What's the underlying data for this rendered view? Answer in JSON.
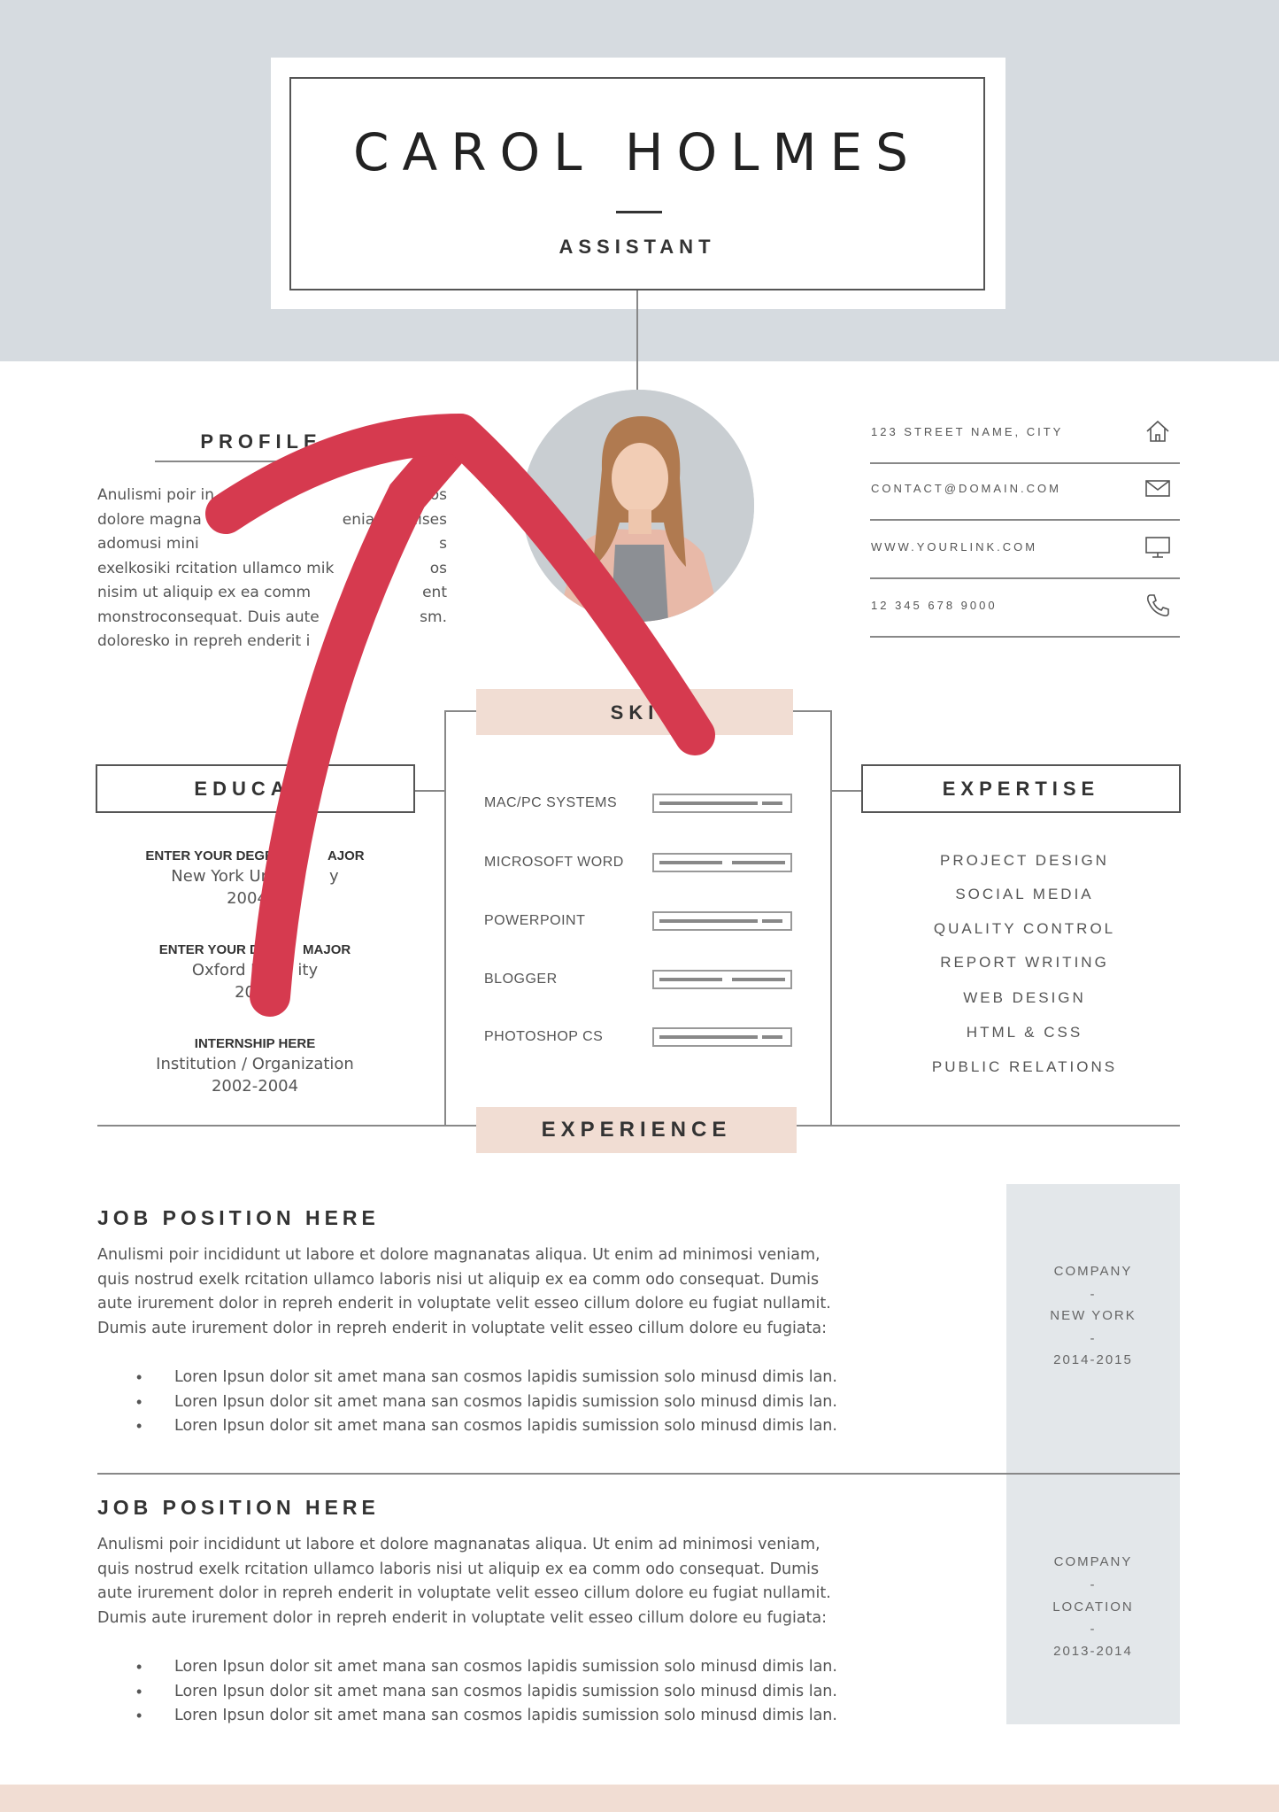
{
  "header": {
    "name": "CAROL HOLMES",
    "title": "ASSISTANT"
  },
  "profile": {
    "heading": "PROFILE",
    "lines": [
      "Anulismi poir in",
      "dolore magna",
      "adomusi mini",
      "exelkosiki rcitation ullamco mik",
      "nisim ut aliquip ex ea comm",
      "monstroconsequat. Duis aute",
      "doloresko in repreh enderit i"
    ],
    "lines_right": [
      "",
      "otipos",
      "eniam, quises",
      "s",
      "os",
      "ent",
      "sm."
    ]
  },
  "contact": [
    {
      "label": "123 STREET NAME, CITY",
      "icon": "home-icon"
    },
    {
      "label": "CONTACT@DOMAIN.COM",
      "icon": "mail-icon"
    },
    {
      "label": "WWW.YOURLINK.COM",
      "icon": "monitor-icon"
    },
    {
      "label": "12 345 678 9000",
      "icon": "phone-icon"
    }
  ],
  "skills": {
    "heading": "SKI",
    "items": [
      {
        "label": "MAC/PC SYSTEMS",
        "level": 0.88
      },
      {
        "label": "MICROSOFT WORD",
        "level": 0.75
      },
      {
        "label": "POWERPOINT",
        "level": 0.88
      },
      {
        "label": "BLOGGER",
        "level": 0.75
      },
      {
        "label": "PHOTOSHOP CS",
        "level": 0.88
      }
    ]
  },
  "education": {
    "heading": "EDUCATI",
    "items": [
      {
        "degree": "ENTER YOUR DEGR",
        "degree_right": "AJOR",
        "school": "New York Ur",
        "school_right": "y",
        "years": "2004-2"
      },
      {
        "degree": "ENTER YOUR DI",
        "degree_right": "MAJOR",
        "school": "Oxford U",
        "school_right": "ity",
        "years": "2002"
      },
      {
        "degree": "INTERNSHIP HERE",
        "degree_right": "",
        "school": "Institution / Organization",
        "school_right": "",
        "years": "2002-2004"
      }
    ]
  },
  "expertise": {
    "heading": "EXPERTISE",
    "items": [
      "PROJECT DESIGN",
      "SOCIAL MEDIA",
      "QUALITY CONTROL",
      "REPORT WRITING",
      "WEB DESIGN",
      "HTML & CSS",
      "PUBLIC RELATIONS"
    ]
  },
  "experience": {
    "heading": "EXPERIENCE",
    "jobs": [
      {
        "title": "JOB POSITION HERE",
        "desc": [
          "Anulismi poir incididunt ut labore et dolore magnanatas aliqua. Ut enim ad minimosi veniam,",
          "quis nostrud exelk rcitation ullamco laboris nisi ut aliquip ex ea comm odo consequat. Dumis",
          "aute irurement dolor in repreh enderit in voluptate velit esseo cillum dolore eu fugiat nullamit.",
          "Dumis aute irurement dolor in repreh enderit in voluptate velit esseo cillum dolore eu fugiata:"
        ],
        "bullets": [
          "Loren Ipsun dolor sit amet mana san cosmos lapidis sumission solo minusd dimis lan.",
          "Loren Ipsun dolor sit amet mana san cosmos lapidis sumission solo minusd dimis lan.",
          "Loren Ipsun dolor sit amet mana san cosmos lapidis sumission solo minusd dimis lan."
        ],
        "company": "COMPANY",
        "sep1": "-",
        "location": "NEW YORK",
        "sep2": "-",
        "years": "2014-2015"
      },
      {
        "title": "JOB POSITION HERE",
        "desc": [
          "Anulismi poir incididunt ut labore et dolore magnanatas aliqua. Ut enim ad minimosi veniam,",
          "quis nostrud exelk rcitation ullamco laboris nisi ut aliquip ex ea comm odo consequat. Dumis",
          "aute irurement dolor in repreh enderit in voluptate velit esseo cillum dolore eu fugiat nullamit.",
          "Dumis aute irurement dolor in repreh enderit in voluptate velit esseo cillum dolore eu fugiata:"
        ],
        "bullets": [
          "Loren Ipsun dolor sit amet mana san cosmos lapidis sumission solo minusd dimis lan.",
          "Loren Ipsun dolor sit amet mana san cosmos lapidis sumission solo minusd dimis lan.",
          "Loren Ipsun dolor sit amet mana san cosmos lapidis sumission solo minusd dimis lan."
        ],
        "company": "COMPANY",
        "sep1": "-",
        "location": "LOCATION",
        "sep2": "-",
        "years": "2013-2014"
      }
    ]
  },
  "colors": {
    "accent_pink": "#f1ddd3",
    "header_gray": "#d6dbe0",
    "arrow_red": "#d63a4f"
  }
}
